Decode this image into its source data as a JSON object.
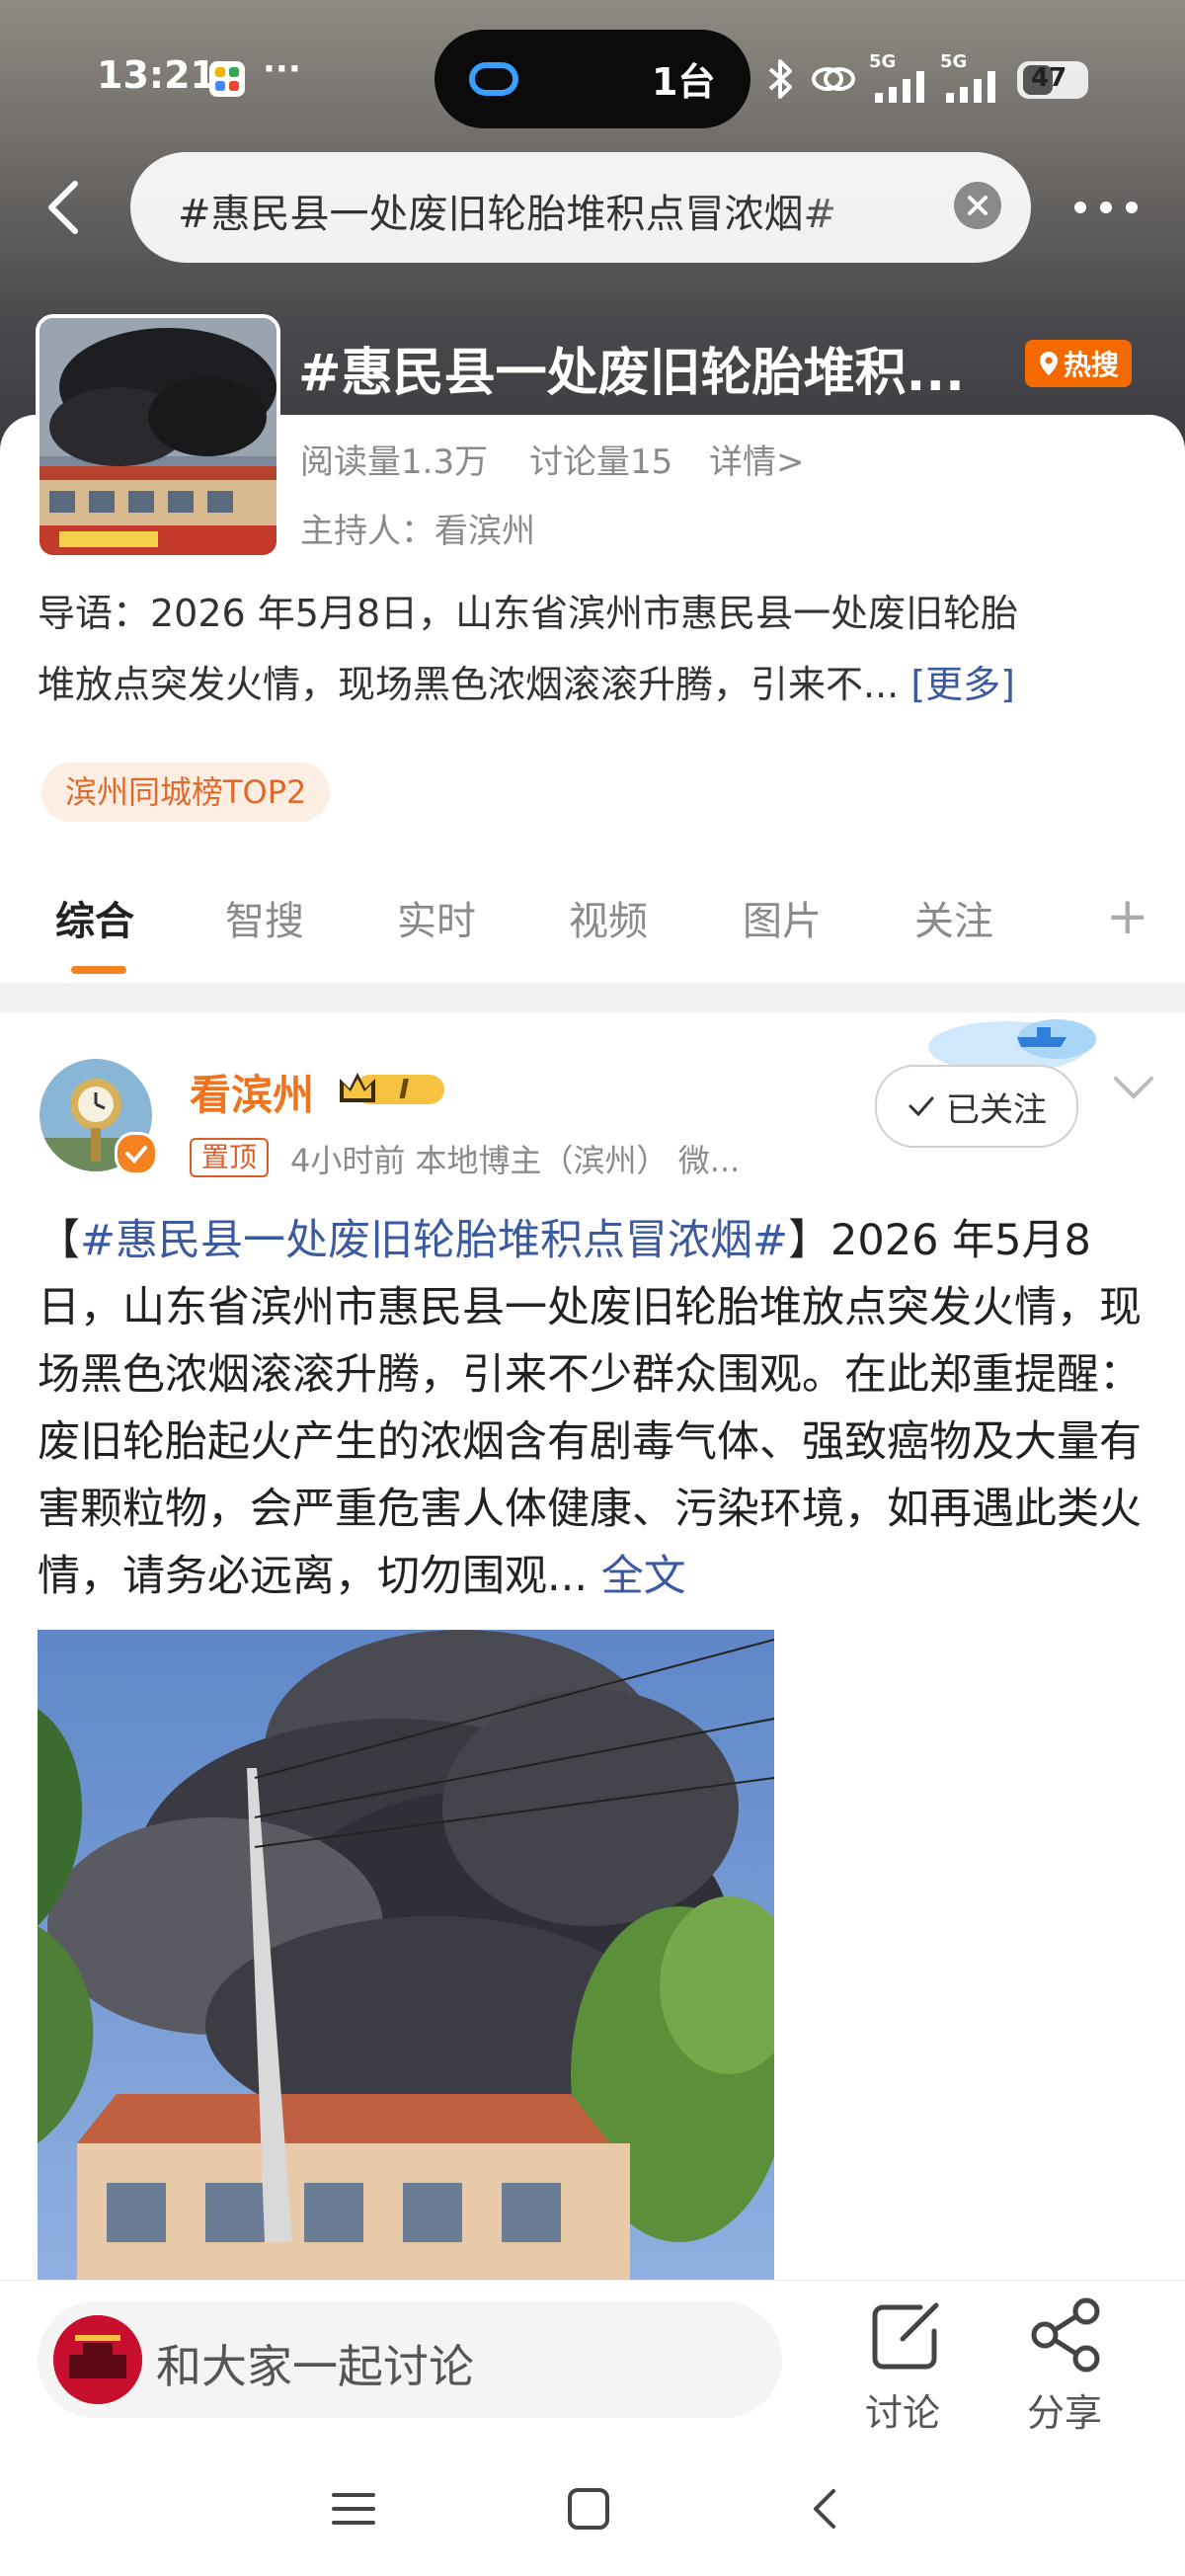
{
  "status_bar": {
    "time": "13:21",
    "dots": "···",
    "island_count": "1台",
    "net1": "5G",
    "net2": "5G",
    "battery": "47"
  },
  "search": {
    "query": "#惠民县一处废旧轮胎堆积点冒浓烟#"
  },
  "topic": {
    "title": "#惠民县一处废旧轮胎堆积...",
    "hot_label": "热搜",
    "reads": "阅读量1.3万",
    "discussions": "讨论量15",
    "details": "详情>",
    "host": "主持人：看滨州",
    "lead_line1": "导语：2026 年5月8日，山东省滨州市惠民县一处废旧轮胎",
    "lead_line2": "堆放点突发火情，现场黑色浓烟滚滚升腾，引来不...",
    "lead_more": "[更多]",
    "rank_tag": "滨州同城榜TOP2"
  },
  "tabs": [
    "综合",
    "智搜",
    "实时",
    "视频",
    "图片",
    "关注"
  ],
  "post": {
    "author": "看滨州",
    "badge_text": "I",
    "pin_label": "置顶",
    "meta": "4小时前   本地博主（滨州） 微...",
    "follow_label": "已关注",
    "body_open": "【",
    "body_hashtag": "#惠民县一处废旧轮胎堆积点冒浓烟#",
    "body_text": "】2026 年5月8日，山东省滨州市惠民县一处废旧轮胎堆放点突发火情，现场黑色浓烟滚滚升腾，引来不少群众围观。在此郑重提醒：废旧轮胎起火产生的浓烟含有剧毒气体、强致癌物及大量有害颗粒物，会严重危害人体健康、污染环境，如再遇此类火情，请务必远离，切勿围观...",
    "full_text": "全文"
  },
  "bottom": {
    "comment_placeholder": "和大家一起讨论",
    "discuss_label": "讨论",
    "share_label": "分享"
  },
  "colors": {
    "accent_orange": "#f58220",
    "link_blue": "#3b5aa0",
    "hot_badge": "#f56a00"
  }
}
